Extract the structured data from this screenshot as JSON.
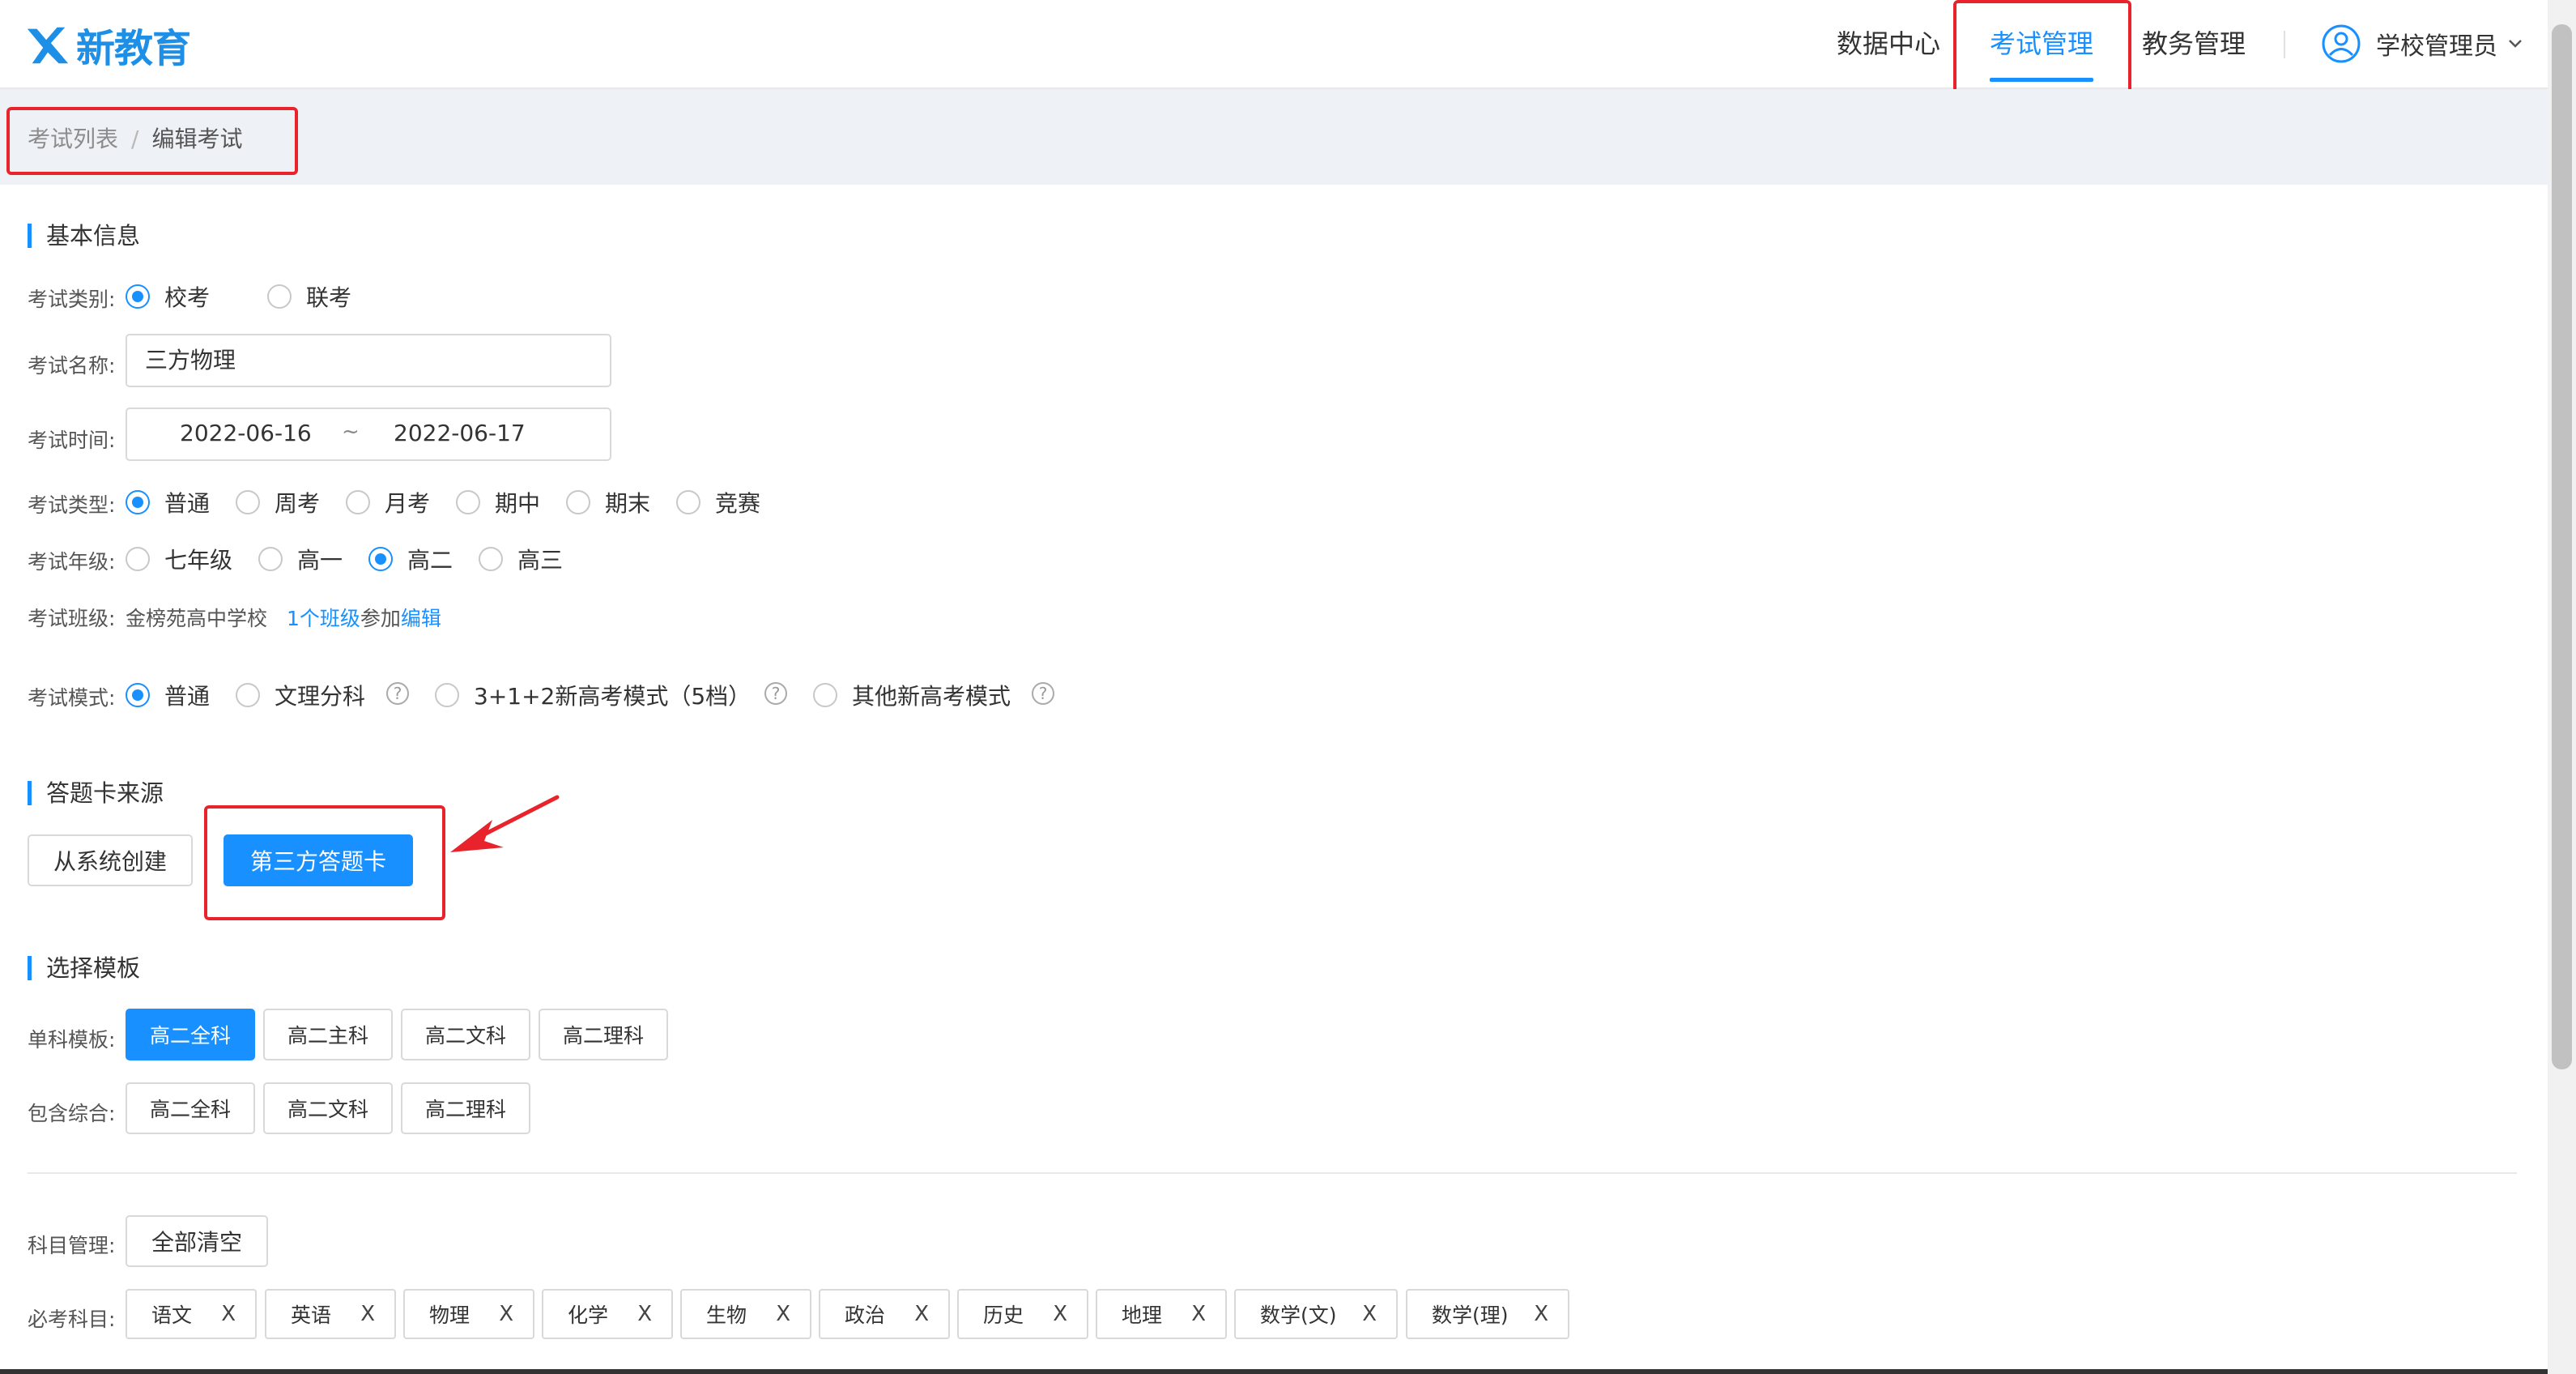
{
  "header": {
    "logo_text": "新教育",
    "nav": [
      "数据中心",
      "考试管理",
      "教务管理"
    ],
    "user_name": "学校管理员"
  },
  "breadcrumb": {
    "parent": "考试列表",
    "separator": "/",
    "current": "编辑考试"
  },
  "basic_info": {
    "title": "基本信息",
    "category": {
      "label": "考试类别:",
      "options": [
        "校考",
        "联考"
      ],
      "selected": "校考"
    },
    "name": {
      "label": "考试名称:",
      "value": "三方物理"
    },
    "time": {
      "label": "考试时间:",
      "start": "2022-06-16",
      "separator": "~",
      "end": "2022-06-17"
    },
    "type": {
      "label": "考试类型:",
      "options": [
        "普通",
        "周考",
        "月考",
        "期中",
        "期末",
        "竞赛"
      ],
      "selected": "普通"
    },
    "grade": {
      "label": "考试年级:",
      "options": [
        "七年级",
        "高一",
        "高二",
        "高三"
      ],
      "selected": "高二"
    },
    "class": {
      "label": "考试班级:",
      "school": "金榜苑高中学校",
      "count_link": "1个班级",
      "join_text": "参加",
      "edit_link": "编辑"
    },
    "mode": {
      "label": "考试模式:",
      "options": [
        "普通",
        "文理分科",
        "3+1+2新高考模式（5档）",
        "其他新高考模式"
      ],
      "selected": "普通"
    }
  },
  "answer_card": {
    "title": "答题卡来源",
    "options": [
      "从系统创建",
      "第三方答题卡"
    ],
    "selected": "第三方答题卡"
  },
  "template": {
    "title": "选择模板",
    "single": {
      "label": "单科模板:",
      "options": [
        "高二全科",
        "高二主科",
        "高二文科",
        "高二理科"
      ],
      "selected": "高二全科"
    },
    "combined": {
      "label": "包含综合:",
      "options": [
        "高二全科",
        "高二文科",
        "高二理科"
      ]
    }
  },
  "subjects": {
    "manage_label": "科目管理:",
    "clear_all": "全部清空",
    "required_label": "必考科目:",
    "items": [
      "语文",
      "英语",
      "物理",
      "化学",
      "生物",
      "政治",
      "历史",
      "地理",
      "数学(文)",
      "数学(理)"
    ],
    "remove_glyph": "X"
  },
  "help_glyph": "?",
  "colors": {
    "primary": "#1890ff",
    "annotation_red": "#e8232b"
  }
}
